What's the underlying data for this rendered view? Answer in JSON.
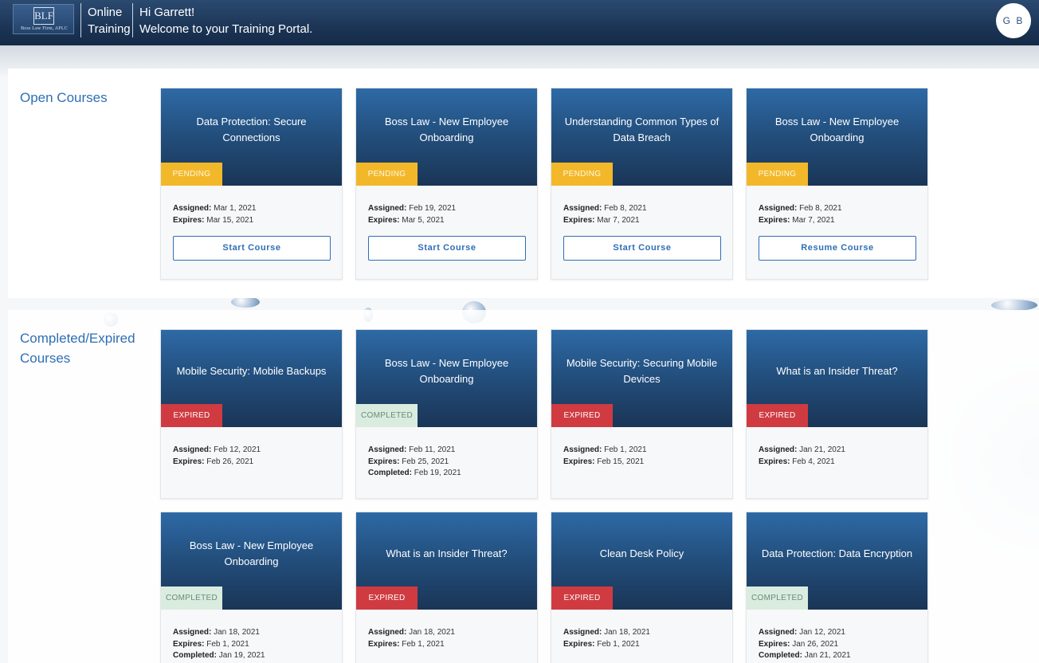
{
  "header": {
    "logo_monogram": "BLF",
    "logo_firm_name": "Boss Law Firm, APLC",
    "app_title_line1": "Online",
    "app_title_line2": "Training",
    "greeting": "Hi Garrett!",
    "welcome": "Welcome to your Training Portal.",
    "avatar_initials": "G B"
  },
  "labels": {
    "assigned": "Assigned:",
    "expires": "Expires:",
    "completed": "Completed:"
  },
  "open_courses": {
    "title": "Open Courses",
    "cards": [
      {
        "title": "Data Protection: Secure Connections",
        "status": "PENDING",
        "assigned": "Mar 1, 2021",
        "expires": "Mar 15, 2021",
        "button": "Start Course"
      },
      {
        "title": "Boss Law - New Employee Onboarding",
        "status": "PENDING",
        "assigned": "Feb 19, 2021",
        "expires": "Mar 5, 2021",
        "button": "Start Course"
      },
      {
        "title": "Understanding Common Types of Data Breach",
        "status": "PENDING",
        "assigned": "Feb 8, 2021",
        "expires": "Mar 7, 2021",
        "button": "Start Course"
      },
      {
        "title": "Boss Law - New Employee Onboarding",
        "status": "PENDING",
        "assigned": "Feb 8, 2021",
        "expires": "Mar 7, 2021",
        "button": "Resume Course"
      }
    ]
  },
  "completed_courses": {
    "title_line1": "Completed/Expired",
    "title_line2": "Courses",
    "cards": [
      {
        "title": "Mobile Security: Mobile Backups",
        "status": "EXPIRED",
        "assigned": "Feb 12, 2021",
        "expires": "Feb 26, 2021"
      },
      {
        "title": "Boss Law - New Employee Onboarding",
        "status": "COMPLETED",
        "assigned": "Feb 11, 2021",
        "expires": "Feb 25, 2021",
        "completed": "Feb 19, 2021"
      },
      {
        "title": "Mobile Security: Securing Mobile Devices",
        "status": "EXPIRED",
        "assigned": "Feb 1, 2021",
        "expires": "Feb 15, 2021"
      },
      {
        "title": "What is an Insider Threat?",
        "status": "EXPIRED",
        "assigned": "Jan 21, 2021",
        "expires": "Feb 4, 2021"
      },
      {
        "title": "Boss Law - New Employee Onboarding",
        "status": "COMPLETED",
        "assigned": "Jan 18, 2021",
        "expires": "Feb 1, 2021",
        "completed": "Jan 19, 2021"
      },
      {
        "title": "What is an Insider Threat?",
        "status": "EXPIRED",
        "assigned": "Jan 18, 2021",
        "expires": "Feb 1, 2021"
      },
      {
        "title": "Clean Desk Policy",
        "status": "EXPIRED",
        "assigned": "Jan 18, 2021",
        "expires": "Feb 1, 2021"
      },
      {
        "title": "Data Protection: Data Encryption",
        "status": "COMPLETED",
        "assigned": "Jan 12, 2021",
        "expires": "Jan 26, 2021",
        "completed": "Jan 21, 2021"
      }
    ]
  },
  "colors": {
    "header": "#1c3556",
    "accent": "#2f6eb5",
    "pending": "#f2b82a",
    "expired": "#cf3b41",
    "completed": "#d9ecdf"
  }
}
